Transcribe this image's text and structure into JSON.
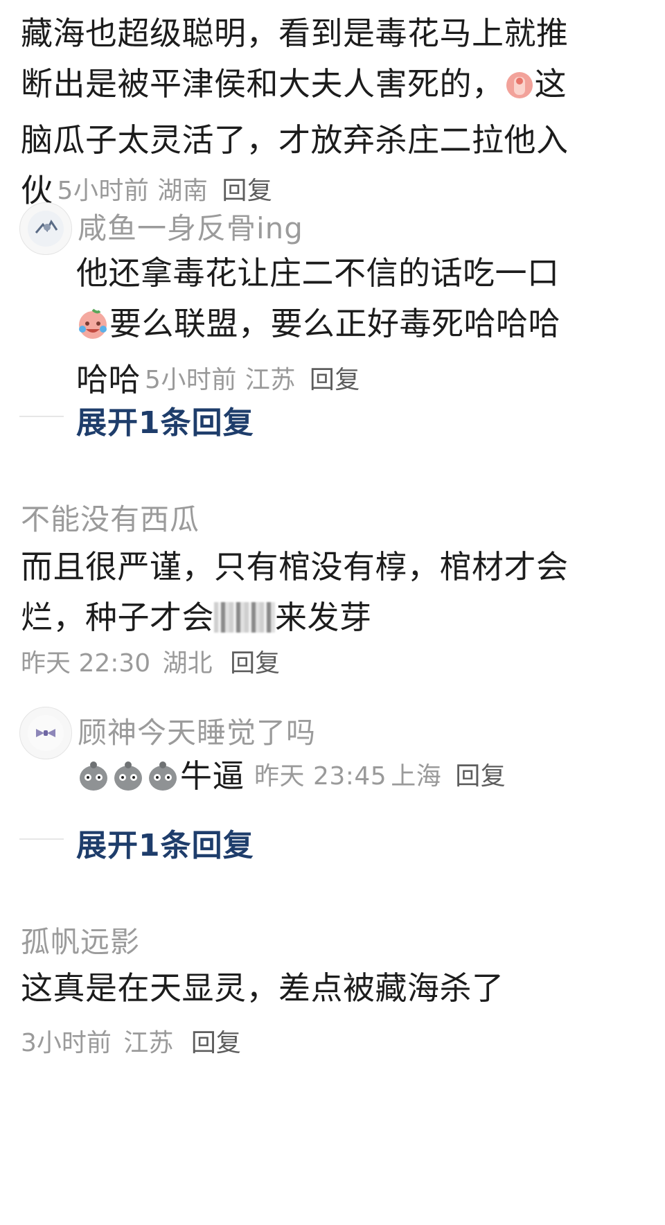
{
  "comment1": {
    "lines": [
      "藏海也超级聪明，看到是毒花马上就推",
      "断出是被平津侯和大夫人害死的，",
      "这",
      "脑瓜子太灵活了，才放弃杀庄二拉他入",
      "伙"
    ],
    "time": "5小时前",
    "location": "湖南",
    "reply_label": "回复",
    "emoji": "thumbs-up-icon"
  },
  "reply1": {
    "username": "咸鱼一身反骨ing",
    "lines": [
      "他还拿毒花让庄二不信的话吃一口",
      "要么联盟，要么正好毒死哈哈哈",
      "哈哈"
    ],
    "time": "5小时前",
    "location": "江苏",
    "reply_label": "回复",
    "emoji": "crying-laughing-face-icon",
    "avatar": "floral-avatar"
  },
  "expand1": {
    "label": "展开1条回复"
  },
  "comment2": {
    "username": "不能没有西瓜",
    "lines": [
      "而且很严谨，只有棺没有椁，棺材才会",
      "烂，种子才会",
      "来发芽"
    ],
    "time": "昨天 22:30",
    "location": "湖北",
    "reply_label": "回复"
  },
  "reply2": {
    "username": "顾神今天睡觉了吗",
    "text": "牛逼",
    "time": "昨天 23:45",
    "location": "上海",
    "reply_label": "回复",
    "emoji": "grey-face-icon",
    "avatar": "bow-avatar"
  },
  "expand2": {
    "label": "展开1条回复"
  },
  "comment3": {
    "username": "孤帆远影",
    "text": "这真是在天显灵，差点被藏海杀了",
    "time": "3小时前",
    "location": "江苏",
    "reply_label": "回复"
  },
  "colors": {
    "link": "#1e3d6b",
    "muted": "#9a9a9a",
    "text": "#1c1c1c"
  }
}
